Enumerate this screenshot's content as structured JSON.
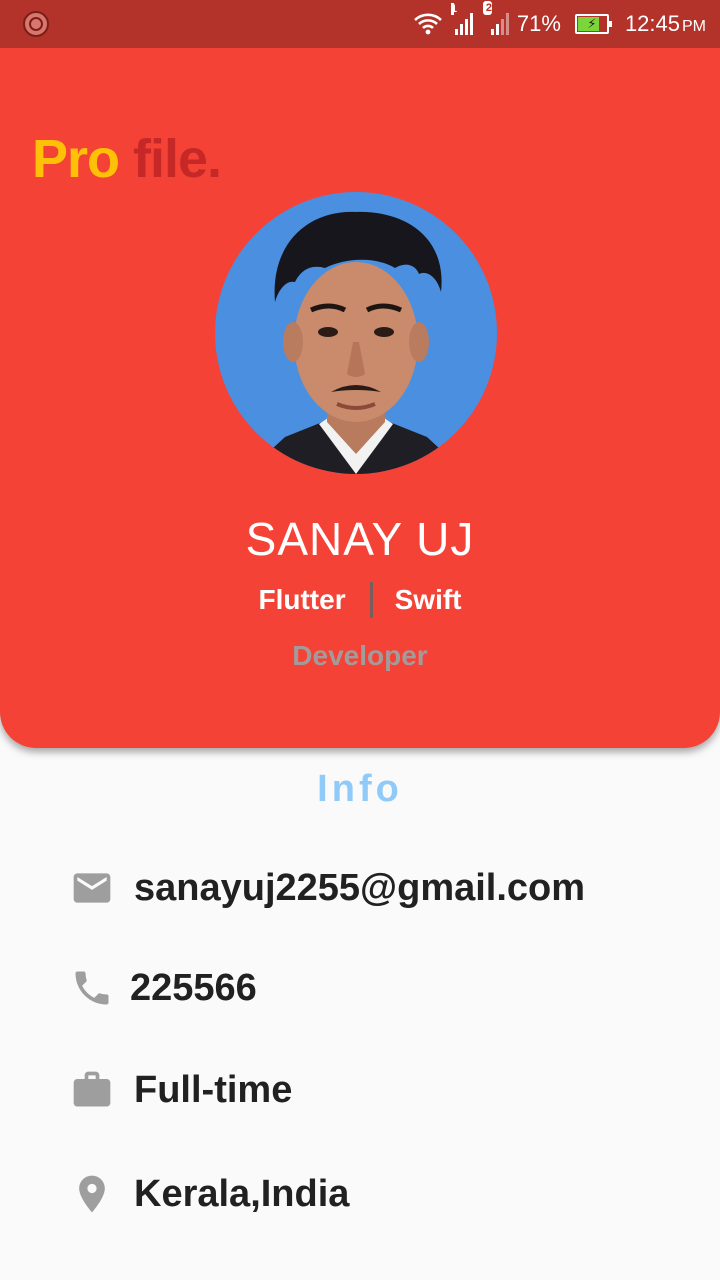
{
  "status_bar": {
    "sim1_label": "1",
    "sim2_label": "2",
    "battery": "71%",
    "time": "12:45",
    "ampm": "PM",
    "icons": [
      "notification-icon",
      "wifi-icon",
      "signal-icon",
      "battery-charging-icon"
    ]
  },
  "header": {
    "logo_part1": "Pro",
    "logo_part2": "file.",
    "name": "SANAY UJ",
    "skill_1": "Flutter",
    "skill_2": "Swift",
    "role": "Developer"
  },
  "info": {
    "title": "Info",
    "items": [
      {
        "icon": "email-icon",
        "text": "sanayuj2255@gmail.com"
      },
      {
        "icon": "phone-icon",
        "text": "225566"
      },
      {
        "icon": "briefcase-icon",
        "text": "Full-time"
      },
      {
        "icon": "location-pin-icon",
        "text": "Kerala,India"
      }
    ]
  },
  "colors": {
    "header": "#f44336",
    "status_bar": "#b3322a",
    "logo_accent": "#ffc107",
    "logo_dark": "#c62828",
    "info_title": "#90caf9",
    "icon_grey": "#9e9e9e"
  }
}
